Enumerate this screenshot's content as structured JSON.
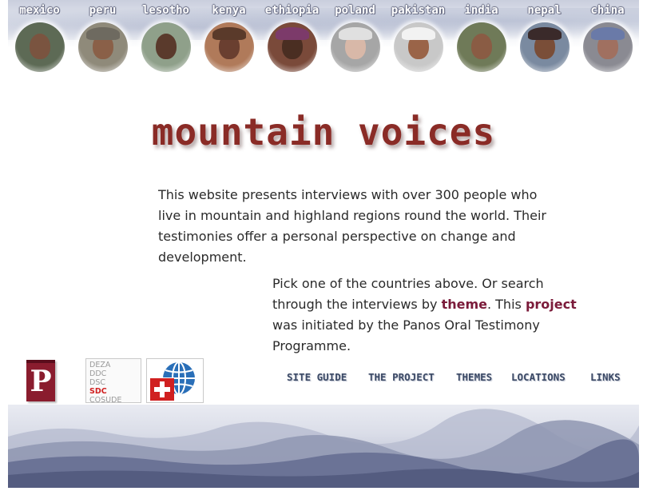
{
  "countries": [
    {
      "name": "mexico",
      "skin": "#7a5440",
      "bg": "#5d6a55",
      "hat": ""
    },
    {
      "name": "peru",
      "skin": "#8a6048",
      "bg": "#8f8a7a",
      "hat": "#6e6a60"
    },
    {
      "name": "lesotho",
      "skin": "#5a3a2c",
      "bg": "#8fa08a",
      "hat": ""
    },
    {
      "name": "kenya",
      "skin": "#6a3f30",
      "bg": "#b07a5a",
      "hat": "#5a3a2a"
    },
    {
      "name": "ethiopia",
      "skin": "#4a2e22",
      "bg": "#7a4a3a",
      "hat": "#7c3a6a"
    },
    {
      "name": "poland",
      "skin": "#d8b8a8",
      "bg": "#a6a6a6",
      "hat": "#e0e0e0"
    },
    {
      "name": "pakistan",
      "skin": "#9a6448",
      "bg": "#c8c8c8",
      "hat": "#f2f2f2"
    },
    {
      "name": "india",
      "skin": "#8a5c44",
      "bg": "#6f7a58",
      "hat": ""
    },
    {
      "name": "nepal",
      "skin": "#7a4e38",
      "bg": "#7a8aa0",
      "hat": "#3a2a2a"
    },
    {
      "name": "china",
      "skin": "#a07060",
      "bg": "#8a8a92",
      "hat": "#6a7aa8"
    }
  ],
  "site": {
    "title": "mountain voices"
  },
  "intro": {
    "text": "This website presents interviews with over 300 people who live in mountain and highland regions round the world. Their testimonies offer a personal perspective on change and development."
  },
  "pick": {
    "text1": "Pick one of the countries above. Or search through the interviews by ",
    "theme_link": "theme",
    "text2": ". This ",
    "project_link": "project",
    "text3": " was initiated by the Panos Oral Testimony Programme."
  },
  "logos": {
    "panos_letter": "P",
    "deza_lines": [
      "DEZA",
      "DDC",
      "DSC",
      "SDC",
      "COSUDE"
    ]
  },
  "nav": [
    {
      "label": "SITE GUIDE"
    },
    {
      "label": "THE PROJECT"
    },
    {
      "label": "THEMES"
    },
    {
      "label": "LOCATIONS"
    },
    {
      "label": "LINKS"
    }
  ],
  "colors": {
    "title": "#8a2b26",
    "link": "#7b1b3a",
    "nav": "#3c4a66",
    "panos": "#8a1c2e",
    "sdc_red": "#d02020",
    "sdc_blue": "#2a6fb8"
  }
}
